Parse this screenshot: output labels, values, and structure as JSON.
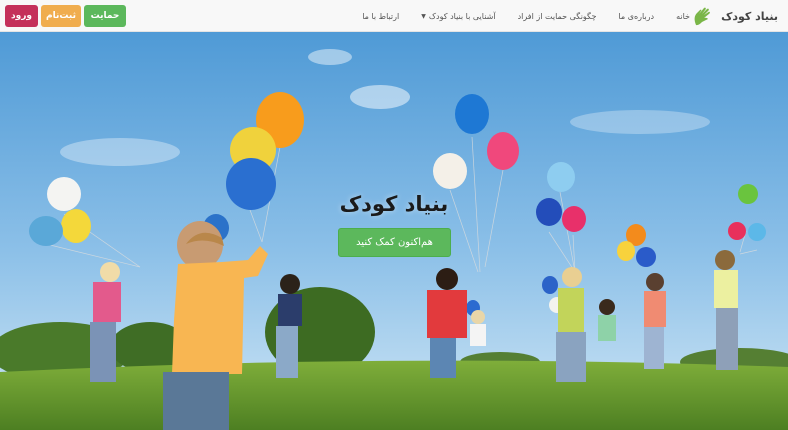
{
  "navbar": {
    "brand_title": "بنیاد کودک",
    "logo_icon": "hand-logo-icon",
    "menu": [
      {
        "label": "خانه"
      },
      {
        "label": "درباره‌ی ما"
      },
      {
        "label": "چگونگی حمایت از افراد"
      },
      {
        "label": "آشنایی با بنیاد کودک"
      },
      {
        "label": "ارتباط با ما"
      }
    ],
    "buttons": {
      "login": "ورود",
      "signup": "ثبت‌نام",
      "support": "حمایت"
    }
  },
  "hero": {
    "title": "بنیاد کودک",
    "cta_label": "هم‌اکنون کمک کنید",
    "scene": "children-with-balloons-image"
  },
  "colors": {
    "login": "#c4305a",
    "signup": "#f0ad4e",
    "support": "#5cb85c",
    "logo": "#7ab648",
    "cta": "#5cb85c"
  }
}
